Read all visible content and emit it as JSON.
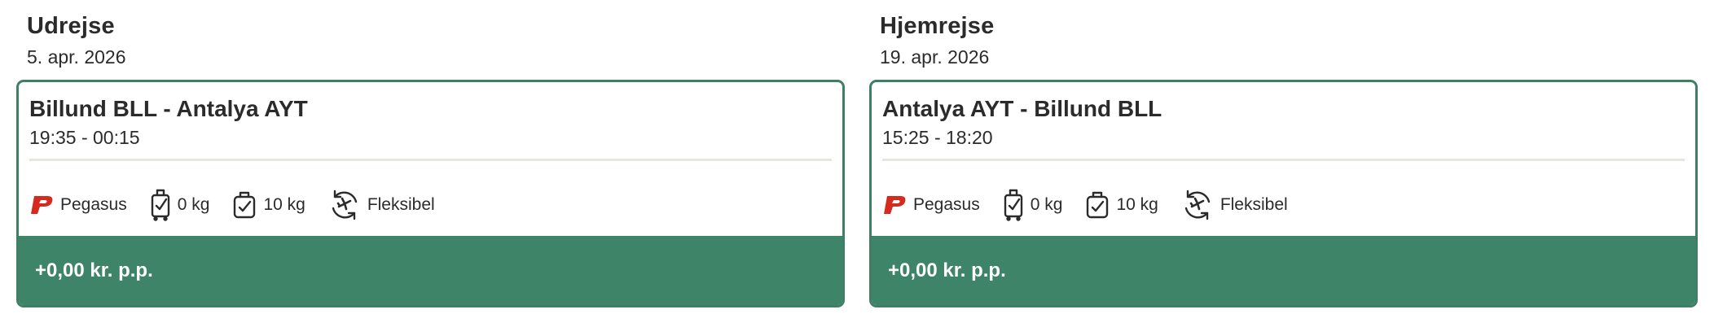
{
  "outbound": {
    "heading": "Udrejse",
    "date": "5. apr. 2026",
    "route": "Billund BLL - Antalya AYT",
    "times": "19:35 - 00:15",
    "airline": "Pegasus",
    "carry_on": "0 kg",
    "checked_bag": "10 kg",
    "flex": "Fleksibel",
    "price": "+0,00 kr. p.p."
  },
  "return": {
    "heading": "Hjemrejse",
    "date": "19. apr. 2026",
    "route": "Antalya AYT - Billund BLL",
    "times": "15:25 - 18:20",
    "airline": "Pegasus",
    "carry_on": "0 kg",
    "checked_bag": "10 kg",
    "flex": "Fleksibel",
    "price": "+0,00 kr. p.p."
  },
  "icons": {
    "airline": "pegasus-logo-icon",
    "carry_on": "carry-on-suitcase-icon",
    "checked_bag": "checked-bag-icon",
    "flex": "flexible-rebooking-icon"
  },
  "colors": {
    "accent": "#3e8468",
    "border": "#3e7f66",
    "airline_logo": "#d52b1e",
    "divider": "#e8e6dc"
  }
}
